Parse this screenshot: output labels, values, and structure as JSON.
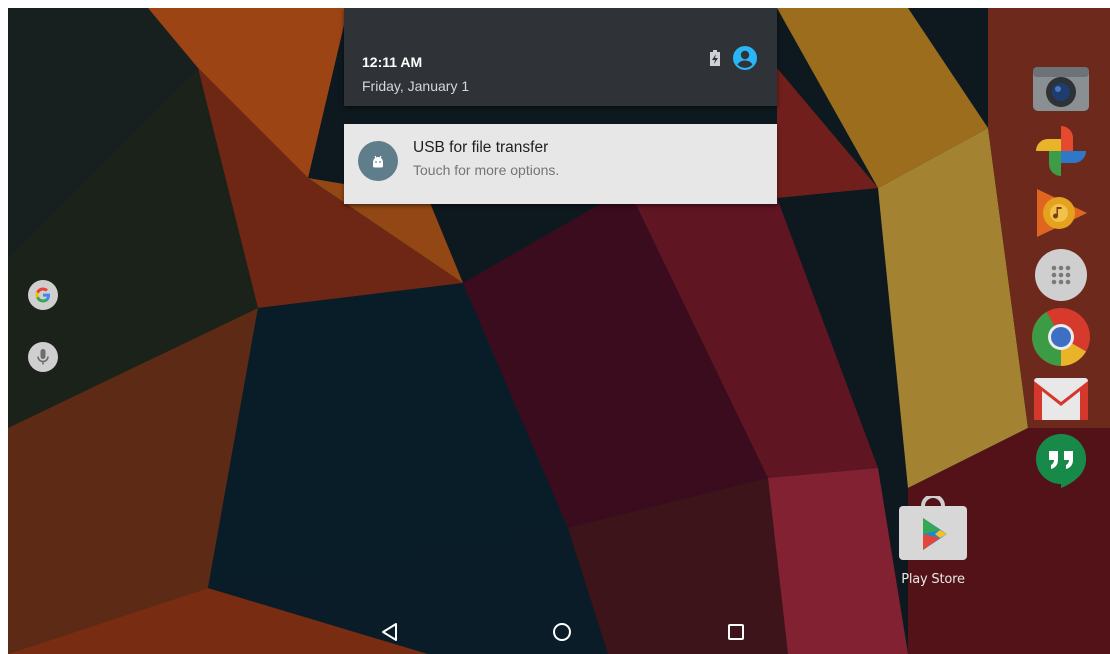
{
  "notification_panel": {
    "time": "12:11 AM",
    "date": "Friday, January 1"
  },
  "notification": {
    "title": "USB for file transfer",
    "text": "Touch for more options."
  },
  "home": {
    "playstore_label": "Play Store"
  },
  "icons": {
    "left": [
      "google-search-icon",
      "microphone-icon"
    ],
    "dock": [
      "camera-icon",
      "photos-icon",
      "play-music-icon",
      "app-drawer-icon",
      "chrome-icon",
      "gmail-icon",
      "hangouts-icon"
    ],
    "status": [
      "battery-charging-icon",
      "user-avatar-icon"
    ],
    "nav": [
      "back-icon",
      "home-icon",
      "recents-icon"
    ]
  },
  "colors": {
    "panel": "#2f3337",
    "card": "#e7e7e7",
    "accent": "#29b6f6"
  }
}
